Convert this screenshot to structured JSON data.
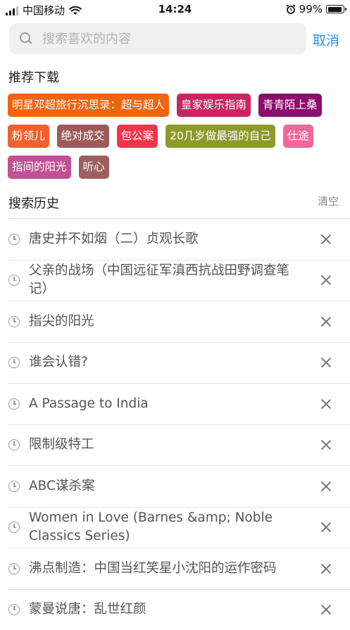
{
  "status_bar": {
    "carrier": "中国移动",
    "time": "14:24",
    "battery": "99%",
    "battery_level": 0.99
  },
  "search": {
    "placeholder": "搜索喜欢的内容",
    "value": "",
    "cancel_label": "取消"
  },
  "recommend": {
    "title": "推荐下载",
    "tags": [
      {
        "label": "明星邓超旅行沉思录：超与超人",
        "color": "#f2650f"
      },
      {
        "label": "皇家娱乐指南",
        "color": "#c8265e"
      },
      {
        "label": "青青陌上桑",
        "color": "#8c0d6b"
      },
      {
        "label": "粉领儿",
        "color": "#f2602f"
      },
      {
        "label": "绝对成交",
        "color": "#9e5a5a"
      },
      {
        "label": "包公案",
        "color": "#f2364a"
      },
      {
        "label": "20几岁做最强的自己",
        "color": "#8d9a2a"
      },
      {
        "label": "仕途",
        "color": "#f0679a"
      },
      {
        "label": "指间的阳光",
        "color": "#c25094"
      },
      {
        "label": "听心",
        "color": "#9c5e60"
      }
    ]
  },
  "history": {
    "title": "搜索历史",
    "clear_label": "清空",
    "items": [
      {
        "text": "唐史并不如烟（二）贞观长歌"
      },
      {
        "text": "父亲的战场（中国远征军滇西抗战田野调查笔记）"
      },
      {
        "text": "指尖的阳光"
      },
      {
        "text": "谁会认错?"
      },
      {
        "text": "A Passage to India"
      },
      {
        "text": "限制级特工"
      },
      {
        "text": "ABC谋杀案"
      },
      {
        "text": "Women in Love (Barnes &amp; Noble Classics Series)"
      },
      {
        "text": "沸点制造：中国当红笑星小沈阳的运作密码"
      },
      {
        "text": "蒙曼说唐：乱世红颜"
      }
    ]
  }
}
